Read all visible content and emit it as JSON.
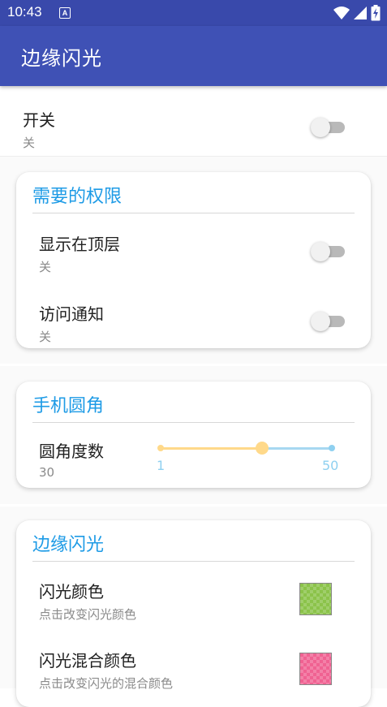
{
  "status_bar": {
    "time": "10:43",
    "notification_icon": "A",
    "icons": [
      "wifi-icon",
      "signal-icon",
      "battery-charging-icon"
    ]
  },
  "app_bar": {
    "title": "边缘闪光"
  },
  "main_switch": {
    "title": "开关",
    "summary": "关",
    "on": false
  },
  "permissions": {
    "header": "需要的权限",
    "overlay": {
      "title": "显示在顶层",
      "summary": "关",
      "on": false
    },
    "notification_access": {
      "title": "访问通知",
      "summary": "关",
      "on": false
    }
  },
  "corner": {
    "header": "手机圆角",
    "radius": {
      "title": "圆角度数",
      "value": "30",
      "min": "1",
      "max": "50"
    }
  },
  "edge_flash": {
    "header": "边缘闪光",
    "flash_color": {
      "title": "闪光颜色",
      "summary": "点击改变闪光颜色",
      "color": "#8bc34a"
    },
    "mix_color": {
      "title": "闪光混合颜色",
      "summary": "点击改变闪光的混合颜色",
      "color": "#f06292"
    }
  },
  "colors": {
    "primary": "#3f51b5",
    "primary_dark": "#3949ab",
    "accent": "#1e9be6"
  }
}
